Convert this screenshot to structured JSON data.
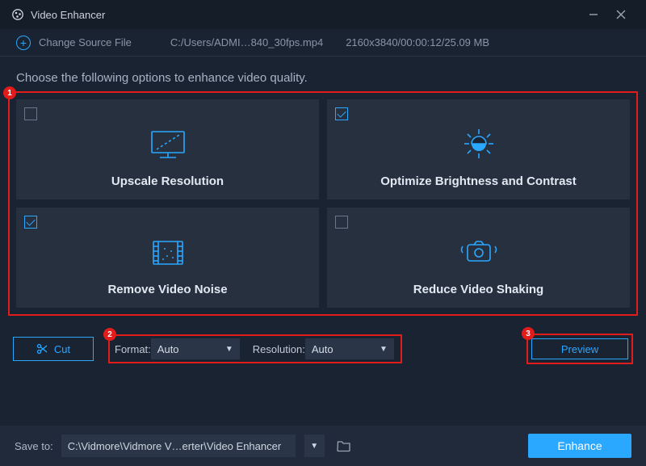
{
  "app": {
    "title": "Video Enhancer"
  },
  "source": {
    "change_label": "Change Source File",
    "file_path": "C:/Users/ADMI…840_30fps.mp4",
    "file_meta": "2160x3840/00:00:12/25.09 MB"
  },
  "instruction": "Choose the following options to enhance video quality.",
  "options": {
    "upscale": {
      "checked": false,
      "label": "Upscale Resolution"
    },
    "brightness": {
      "checked": true,
      "label": "Optimize Brightness and Contrast"
    },
    "noise": {
      "checked": true,
      "label": "Remove Video Noise"
    },
    "shaking": {
      "checked": false,
      "label": "Reduce Video Shaking"
    }
  },
  "controls": {
    "cut_label": "Cut",
    "format_label": "Format:",
    "format_value": "Auto",
    "resolution_label": "Resolution:",
    "resolution_value": "Auto",
    "preview_label": "Preview"
  },
  "bottom": {
    "save_to_label": "Save to:",
    "save_path": "C:\\Vidmore\\Vidmore V…erter\\Video Enhancer",
    "enhance_label": "Enhance"
  },
  "annotations": {
    "one": "1",
    "two": "2",
    "three": "3"
  }
}
